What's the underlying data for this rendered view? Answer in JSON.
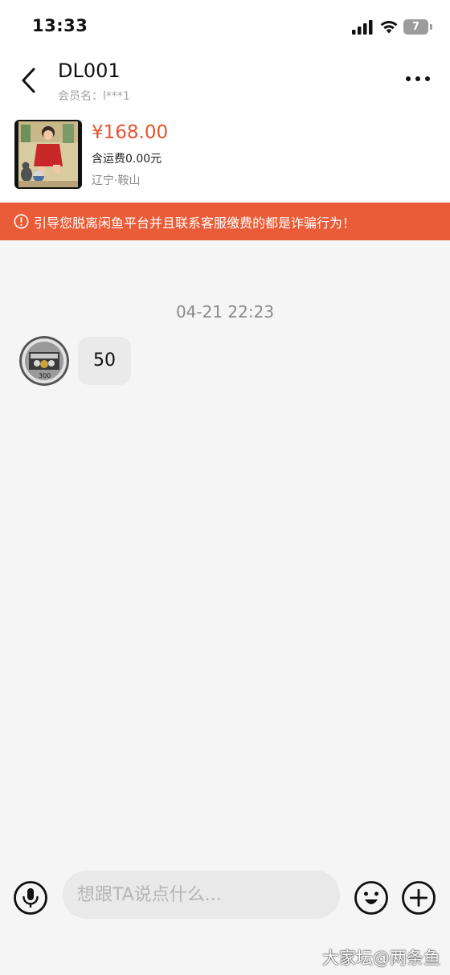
{
  "status_bar": {
    "time": "13:33",
    "battery": "7"
  },
  "nav": {
    "title": "DL001",
    "subtitle": "会员名：l***1"
  },
  "product": {
    "price": "¥168.00",
    "shipping": "含运费0.00元",
    "location": "辽宁·鞍山"
  },
  "warning": {
    "text": "引导您脱离闲鱼平台并且联系客服缴费的都是诈骗行为！",
    "color": "#ea5b37"
  },
  "chat": {
    "timestamp": "04-21 22:23",
    "messages": [
      {
        "text": "50"
      }
    ]
  },
  "input": {
    "placeholder": "想跟TA说点什么..."
  },
  "watermark": "大家坛@两条鱼",
  "colors": {
    "accent": "#e8542c",
    "banner": "#ea5b37",
    "background": "#f5f5f5"
  }
}
